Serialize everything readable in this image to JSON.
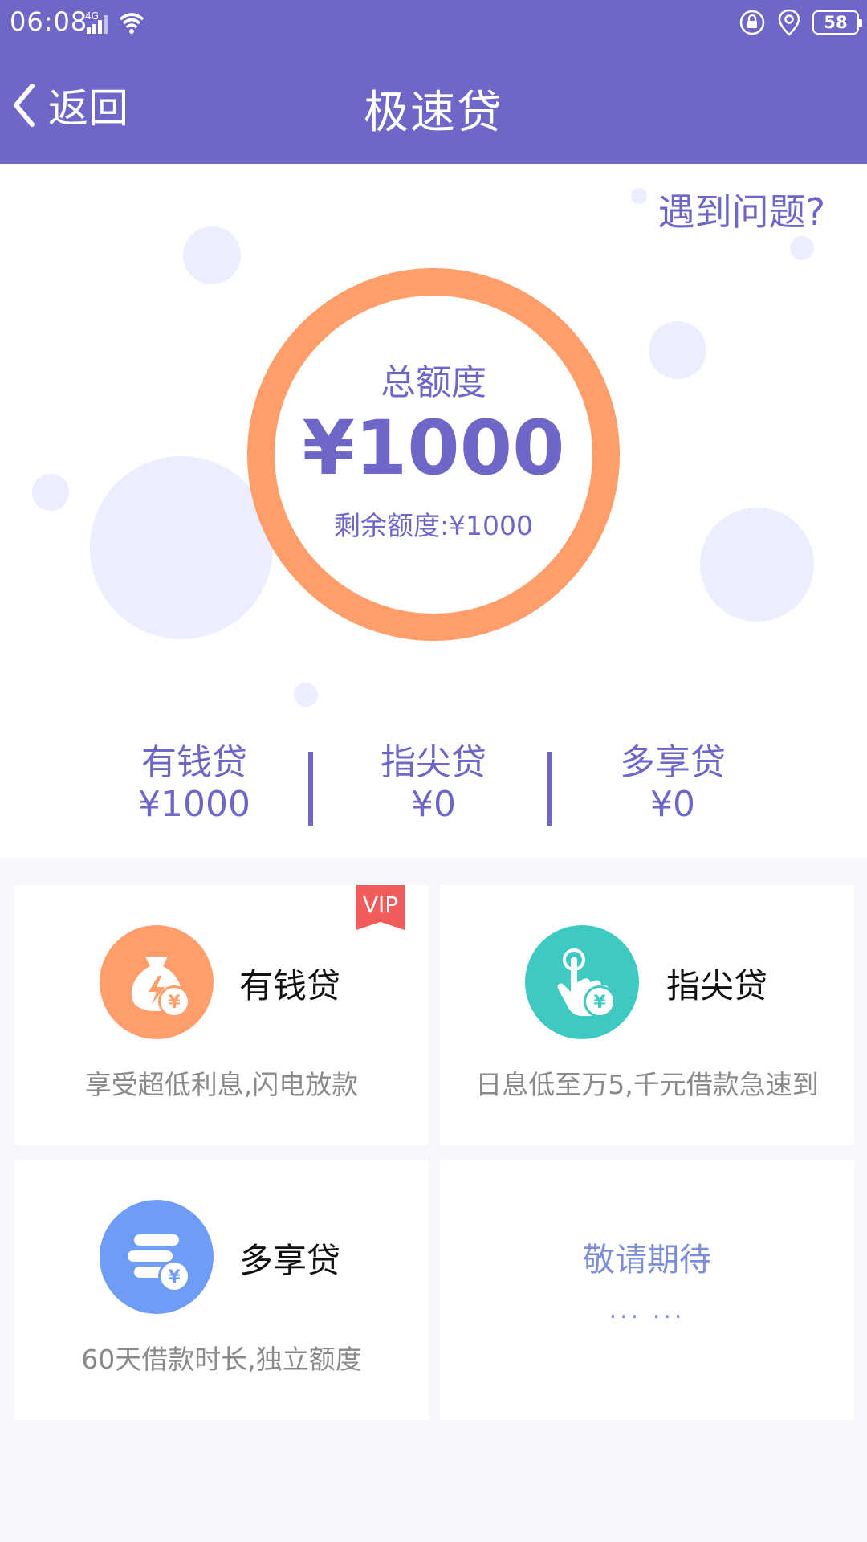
{
  "status_bar": {
    "time": "06:08",
    "network": "4G",
    "battery": "58"
  },
  "header": {
    "back_label": "返回",
    "title": "极速贷"
  },
  "hero": {
    "help_link": "遇到问题?",
    "total_label": "总额度",
    "total_amount": "¥1000",
    "remaining": "剩余额度:¥1000"
  },
  "split": [
    {
      "name": "有钱贷",
      "value": "¥1000"
    },
    {
      "name": "指尖贷",
      "value": "¥0"
    },
    {
      "name": "多享贷",
      "value": "¥0"
    }
  ],
  "cards": [
    {
      "title": "有钱贷",
      "desc": "享受超低利息,闪电放款",
      "badge": "VIP",
      "icon": "money-bag-icon",
      "color": "#ff9e6a"
    },
    {
      "title": "指尖贷",
      "desc": "日息低至万5,千元借款急速到",
      "icon": "finger-tap-icon",
      "color": "#3ec9c3"
    },
    {
      "title": "多享贷",
      "desc": "60天借款时长,独立额度",
      "icon": "coin-stack-icon",
      "color": "#6f9cf7"
    }
  ],
  "coming_soon": {
    "title": "敬请期待",
    "dots": "... ..."
  },
  "colors": {
    "primary": "#6e67c7",
    "ring": "#ff9e6a",
    "bubble": "#eceefd",
    "vip": "#f25b5b"
  }
}
